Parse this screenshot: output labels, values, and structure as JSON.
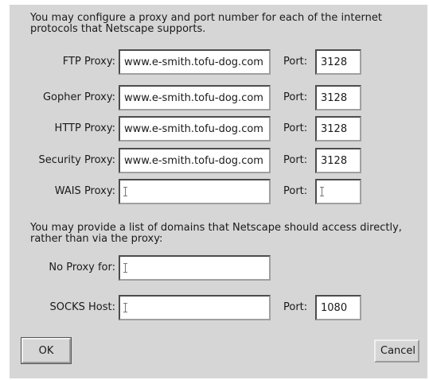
{
  "intro": {
    "proxy_text": "You may configure a proxy and port number for each of the internet\nprotocols that Netscape supports.",
    "domains_text": "You may provide a list of domains that Netscape should access directly,\nrather than via the proxy:"
  },
  "proxies": [
    {
      "label": "FTP Proxy:",
      "value": "www.e-smith.tofu-dog.com",
      "port_label": "Port:",
      "port": "3128"
    },
    {
      "label": "Gopher Proxy:",
      "value": "www.e-smith.tofu-dog.com",
      "port_label": "Port:",
      "port": "3128"
    },
    {
      "label": "HTTP Proxy:",
      "value": "www.e-smith.tofu-dog.com",
      "port_label": "Port:",
      "port": "3128"
    },
    {
      "label": "Security Proxy:",
      "value": "www.e-smith.tofu-dog.com",
      "port_label": "Port:",
      "port": "3128"
    },
    {
      "label": "WAIS Proxy:",
      "value": "",
      "port_label": "Port:",
      "port": ""
    }
  ],
  "no_proxy": {
    "label": "No Proxy for:",
    "value": ""
  },
  "socks": {
    "label": "SOCKS Host:",
    "value": "",
    "port_label": "Port:",
    "port": "1080"
  },
  "buttons": {
    "ok": "OK",
    "cancel": "Cancel"
  }
}
